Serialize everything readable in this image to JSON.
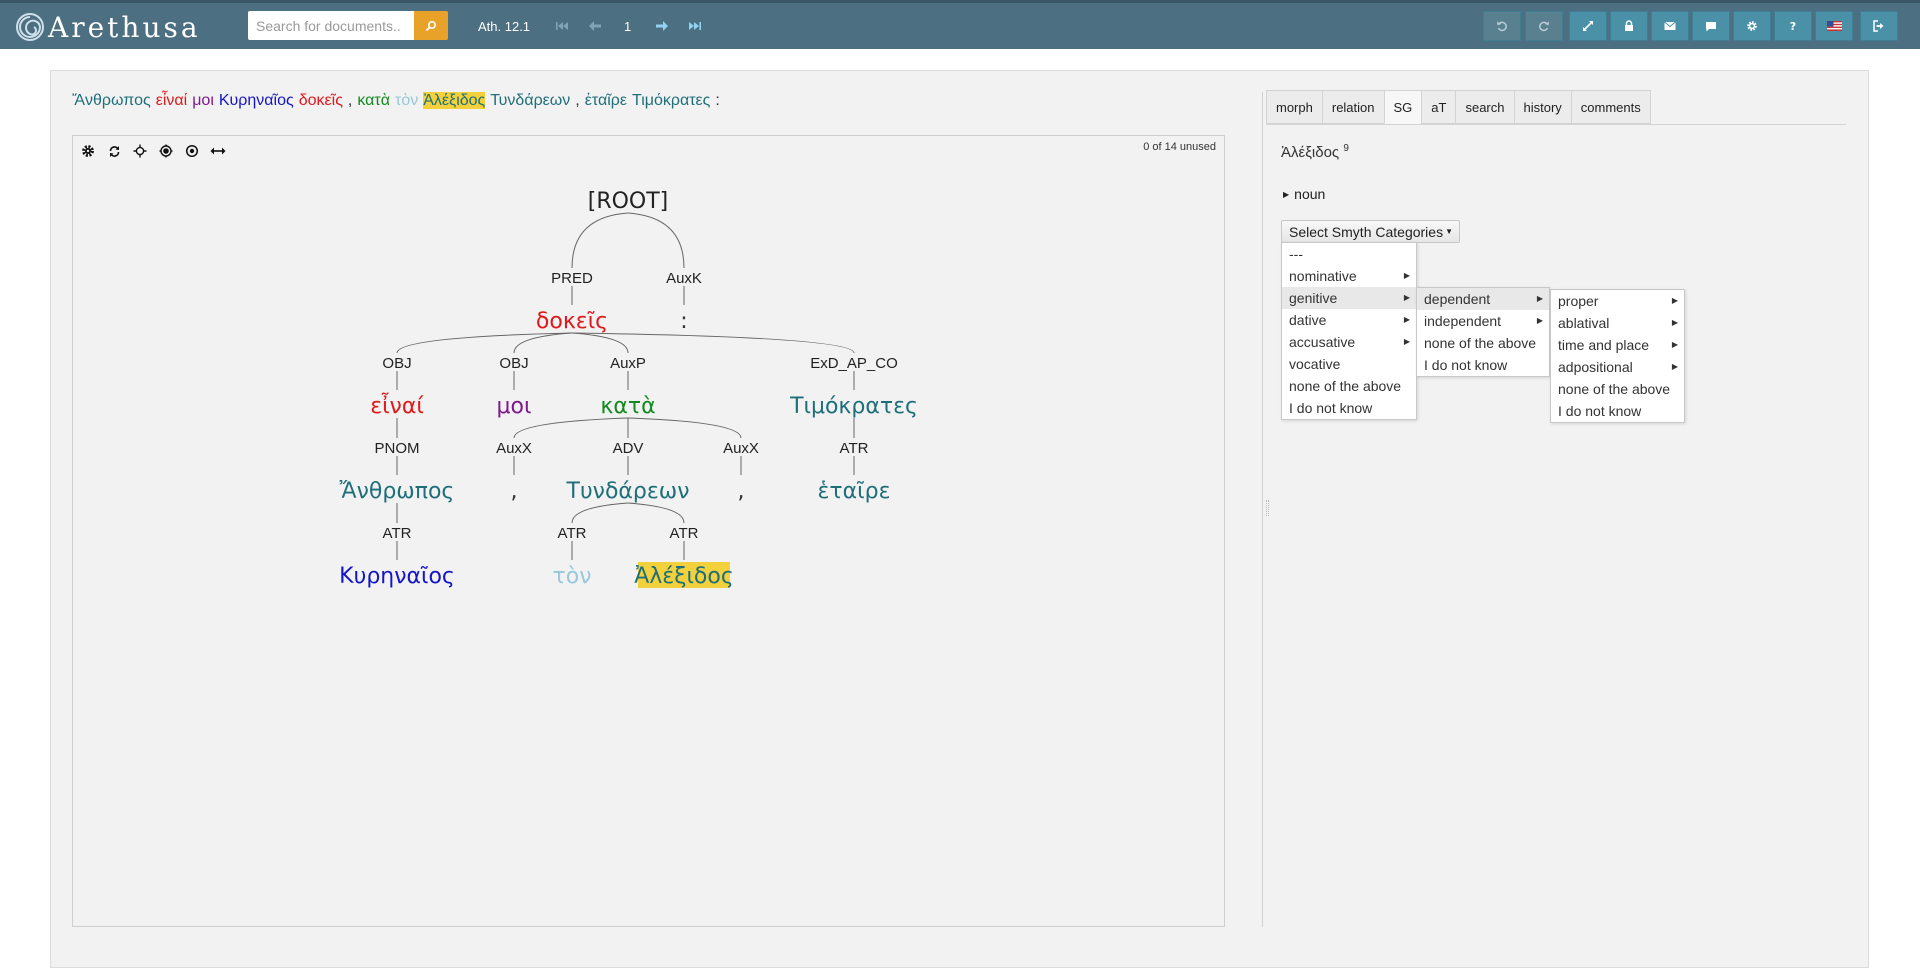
{
  "app": {
    "logo_text": "Arethusa"
  },
  "search": {
    "placeholder": "Search for documents..",
    "value": ""
  },
  "nav": {
    "doc_id": "Ath. 12.1",
    "page": "1"
  },
  "toolbar": {
    "buttons": [
      "undo-icon",
      "redo-icon",
      "expand-icon",
      "lock-icon",
      "mail-icon",
      "comment-icon",
      "gear-icon",
      "help-icon",
      "flag-icon",
      "exit-icon"
    ]
  },
  "sentence": [
    {
      "text": "Ἄνθρωπος",
      "color": "#1f6f7a"
    },
    {
      "text": "εἶναί",
      "color": "#e0191d"
    },
    {
      "text": "μοι",
      "color": "#7e1a8c"
    },
    {
      "text": "Κυρηναῖος",
      "color": "#1515c8"
    },
    {
      "text": "δοκεῖς",
      "color": "#e0191d"
    },
    {
      "text": ",",
      "color": "#333333"
    },
    {
      "text": "κατὰ",
      "color": "#138a1f"
    },
    {
      "text": "τὸν",
      "color": "#99c8dc"
    },
    {
      "text": "Ἀλέξιδος",
      "color": "#1f6f7a",
      "highlight": true
    },
    {
      "text": "Τυνδάρεων",
      "color": "#1f6f7a"
    },
    {
      "text": ",",
      "color": "#333333"
    },
    {
      "text": "ἑταῖρε",
      "color": "#1f6f7a"
    },
    {
      "text": "Τιμόκρατες",
      "color": "#1f6f7a"
    },
    {
      "text": ":",
      "color": "#333333"
    }
  ],
  "tree": {
    "unused_label": "0 of 14 unused",
    "tools": [
      "gear-icon",
      "refresh-icon",
      "center-icon",
      "focus-icon",
      "target-icon",
      "width-icon"
    ],
    "nodes": [
      {
        "id": "root",
        "word": "[ROOT]",
        "color": "#222222",
        "parent": null
      },
      {
        "id": "dokeis",
        "word": "δοκεῖς",
        "rel": "PRED",
        "color": "#e0191d",
        "parent": "root"
      },
      {
        "id": "colon",
        "word": ":",
        "rel": "AuxK",
        "color": "#333333",
        "parent": "root"
      },
      {
        "id": "einai",
        "word": "εἶναί",
        "rel": "OBJ",
        "color": "#e0191d",
        "parent": "dokeis"
      },
      {
        "id": "moi",
        "word": "μοι",
        "rel": "OBJ",
        "color": "#7e1a8c",
        "parent": "dokeis"
      },
      {
        "id": "kata",
        "word": "κατὰ",
        "rel": "AuxP",
        "color": "#138a1f",
        "parent": "dokeis"
      },
      {
        "id": "timokrates",
        "word": "Τιμόκρατες",
        "rel": "ExD_AP_CO",
        "color": "#1f6f7a",
        "parent": "dokeis"
      },
      {
        "id": "anthropos",
        "word": "Ἄνθρωπος",
        "rel": "PNOM",
        "color": "#1f6f7a",
        "parent": "einai"
      },
      {
        "id": "comma1",
        "word": ",",
        "rel": "AuxX",
        "color": "#333333",
        "parent": "kata"
      },
      {
        "id": "tyndareon",
        "word": "Τυνδάρεων",
        "rel": "ADV",
        "color": "#1f6f7a",
        "parent": "kata"
      },
      {
        "id": "comma2",
        "word": ",",
        "rel": "AuxX",
        "color": "#333333",
        "parent": "kata"
      },
      {
        "id": "hetaire",
        "word": "ἑταῖρε",
        "rel": "ATR",
        "color": "#1f6f7a",
        "parent": "timokrates"
      },
      {
        "id": "kyrenaios",
        "word": "Κυρηναῖος",
        "rel": "ATR",
        "color": "#1515c8",
        "parent": "anthropos"
      },
      {
        "id": "ton",
        "word": "τὸν",
        "rel": "ATR",
        "color": "#99c8dc",
        "parent": "tyndareon"
      },
      {
        "id": "alexidos",
        "word": "Ἀλέξιδος",
        "rel": "ATR",
        "color": "#1f6f7a",
        "parent": "tyndareon",
        "highlight": true
      }
    ]
  },
  "tabs": [
    {
      "label": "morph"
    },
    {
      "label": "relation"
    },
    {
      "label": "SG",
      "active": true
    },
    {
      "label": "aT"
    },
    {
      "label": "search"
    },
    {
      "label": "history"
    },
    {
      "label": "comments"
    }
  ],
  "sg": {
    "word": "Ἀλέξιδος",
    "word_index": "9",
    "pos_label": "noun",
    "select_label": "Select Smyth Categories",
    "menu1": [
      {
        "label": "---"
      },
      {
        "label": "nominative",
        "sub": true
      },
      {
        "label": "genitive",
        "sub": true,
        "active": true
      },
      {
        "label": "dative",
        "sub": true
      },
      {
        "label": "accusative",
        "sub": true
      },
      {
        "label": "vocative"
      },
      {
        "label": "none of the above"
      },
      {
        "label": "I do not know"
      }
    ],
    "menu2": [
      {
        "label": "dependent",
        "sub": true,
        "active": true
      },
      {
        "label": "independent",
        "sub": true
      },
      {
        "label": "none of the above"
      },
      {
        "label": "I do not know"
      }
    ],
    "menu3": [
      {
        "label": "proper",
        "sub": true
      },
      {
        "label": "ablatival",
        "sub": true
      },
      {
        "label": "time and place",
        "sub": true
      },
      {
        "label": "adpositional",
        "sub": true
      },
      {
        "label": "none of the above"
      },
      {
        "label": "I do not know"
      }
    ]
  },
  "colors": {
    "topbar": "#4d6f82",
    "accent": "#e8a22a",
    "button": "#4a90a6",
    "highlight": "#f2d13c"
  }
}
